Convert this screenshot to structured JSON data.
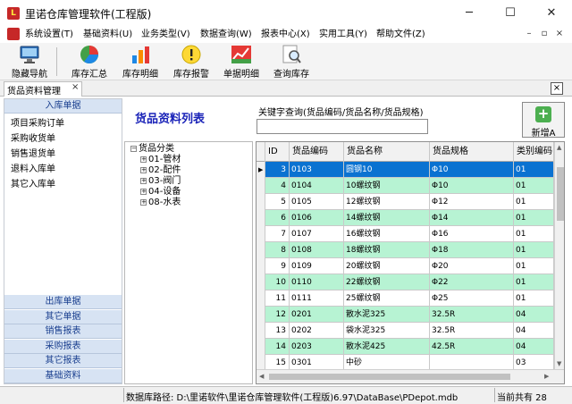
{
  "window": {
    "title": "里诺仓库管理软件(工程版)",
    "app_icon": "logo-icon"
  },
  "menu": [
    "系统设置(T)",
    "基础资料(U)",
    "业务类型(V)",
    "数据查询(W)",
    "报表中心(X)",
    "实用工具(Y)",
    "帮助文件(Z)"
  ],
  "toolbar": [
    "隐藏导航",
    "库存汇总",
    "库存明细",
    "库存报警",
    "单据明细",
    "查询库存"
  ],
  "tab": {
    "label": "货品资料管理",
    "close": "×"
  },
  "nav": {
    "top_header": "入库单据",
    "items": [
      "项目采购订单",
      "采购收货单",
      "销售退货单",
      "退料入库单",
      "其它入库单"
    ],
    "bottom_headers": [
      "出库单据",
      "其它单据",
      "销售报表",
      "采购报表",
      "其它报表",
      "基础资料"
    ]
  },
  "main": {
    "title": "货品资料列表",
    "search_label": "关键字查询(货品编码/货品名称/货品规格)",
    "search_value": "",
    "add_button": "新增A"
  },
  "tree": {
    "root": "货品分类",
    "children": [
      "01-管材",
      "02-配件",
      "03-阀门",
      "04-设备",
      "08-水表"
    ]
  },
  "grid": {
    "columns": [
      "ID",
      "货品编码",
      "货品名称",
      "货品规格",
      "类别编码"
    ],
    "rows": [
      [
        "3",
        "0103",
        "圆钢10",
        "Φ10",
        "01"
      ],
      [
        "4",
        "0104",
        "10螺纹钢",
        "Φ10",
        "01"
      ],
      [
        "5",
        "0105",
        "12螺纹钢",
        "Φ12",
        "01"
      ],
      [
        "6",
        "0106",
        "14螺纹钢",
        "Φ14",
        "01"
      ],
      [
        "7",
        "0107",
        "16螺纹钢",
        "Φ16",
        "01"
      ],
      [
        "8",
        "0108",
        "18螺纹钢",
        "Φ18",
        "01"
      ],
      [
        "9",
        "0109",
        "20螺纹钢",
        "Φ20",
        "01"
      ],
      [
        "10",
        "0110",
        "22螺纹钢",
        "Φ22",
        "01"
      ],
      [
        "11",
        "0111",
        "25螺纹钢",
        "Φ25",
        "01"
      ],
      [
        "12",
        "0201",
        "散水泥325",
        "32.5R",
        "04"
      ],
      [
        "13",
        "0202",
        "袋水泥325",
        "32.5R",
        "04"
      ],
      [
        "14",
        "0203",
        "散水泥425",
        "42.5R",
        "04"
      ],
      [
        "15",
        "0301",
        "中砂",
        "",
        "03"
      ]
    ],
    "selected_index": 0
  },
  "status": {
    "path": "数据库路径: D:\\里诺软件\\里诺仓库管理软件(工程版)6.97\\DataBase\\PDepot.mdb",
    "count": "当前共有 28"
  }
}
